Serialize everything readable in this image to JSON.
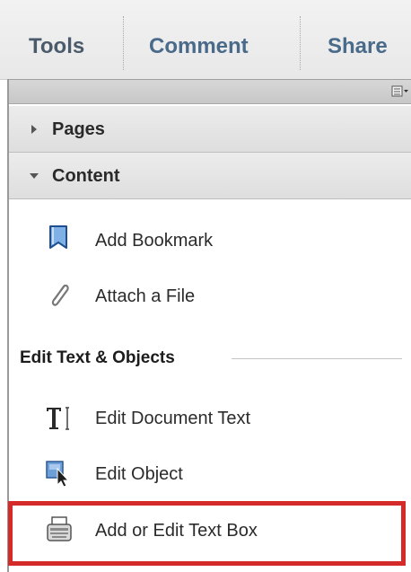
{
  "tabs": [
    {
      "label": "Tools"
    },
    {
      "label": "Comment"
    },
    {
      "label": "Share"
    }
  ],
  "sections": {
    "pages": {
      "label": "Pages",
      "expanded": false
    },
    "content": {
      "label": "Content",
      "expanded": true
    }
  },
  "content_items": [
    {
      "label": "Add Bookmark",
      "icon": "bookmark-icon"
    },
    {
      "label": "Attach a File",
      "icon": "paperclip-icon"
    }
  ],
  "edit_group": {
    "title": "Edit Text & Objects",
    "items": [
      {
        "label": "Edit Document Text",
        "icon": "text-cursor-icon"
      },
      {
        "label": "Edit Object",
        "icon": "edit-object-icon"
      },
      {
        "label": "Add or Edit Text Box",
        "icon": "typewriter-icon",
        "highlighted": true
      }
    ]
  },
  "colors": {
    "highlight": "#d42a2a",
    "tab_text": "#4a6a8a",
    "bookmark_blue": "#5b8fd0"
  }
}
